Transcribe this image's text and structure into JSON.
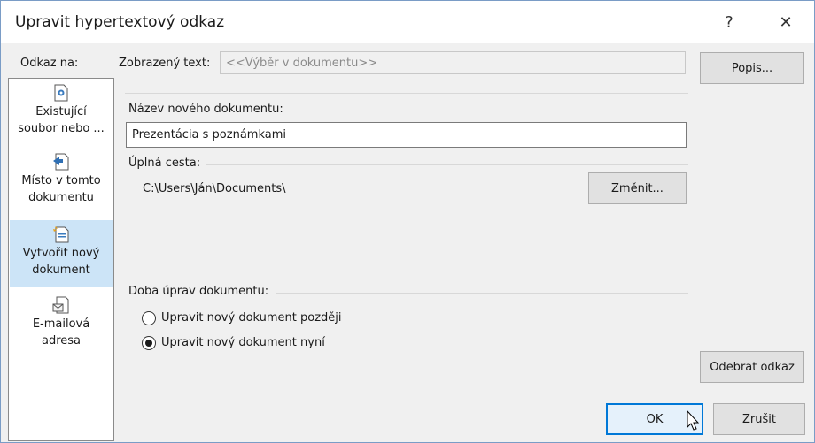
{
  "dialog": {
    "title": "Upravit hypertextový odkaz",
    "help_glyph": "?",
    "close_glyph": "✕"
  },
  "link_to": {
    "label": "Odkaz na:",
    "items": [
      {
        "line1": "Existující",
        "line2": "soubor nebo ...",
        "icon": "existing-file-icon"
      },
      {
        "line1": "Místo v tomto",
        "line2": "dokumentu",
        "icon": "place-in-document-icon"
      },
      {
        "line1": "Vytvořit nový",
        "line2": "dokument",
        "icon": "new-document-icon",
        "selected": true
      },
      {
        "line1": "E-mailová",
        "line2": "adresa",
        "icon": "email-address-icon"
      }
    ]
  },
  "display_text": {
    "label": "Zobrazený text:",
    "value": "<<Výběr v dokumentu>>"
  },
  "screentip_button": "Popis...",
  "new_document": {
    "label": "Název nového dokumentu:",
    "value": "Prezentácia s poznámkami"
  },
  "full_path": {
    "label": "Úplná cesta:",
    "value": "C:\\Users\\Ján\\Documents\\",
    "change_button": "Změnit..."
  },
  "when_to_edit": {
    "label": "Doba úprav dokumentu:",
    "options": [
      {
        "label": "Upravit nový dokument později",
        "checked": false
      },
      {
        "label": "Upravit nový dokument nyní",
        "checked": true
      }
    ]
  },
  "remove_link_button": "Odebrat odkaz",
  "ok_button": "OK",
  "cancel_button": "Zrušit",
  "colors": {
    "accent": "#0078d7",
    "selection": "#cce4f7"
  }
}
